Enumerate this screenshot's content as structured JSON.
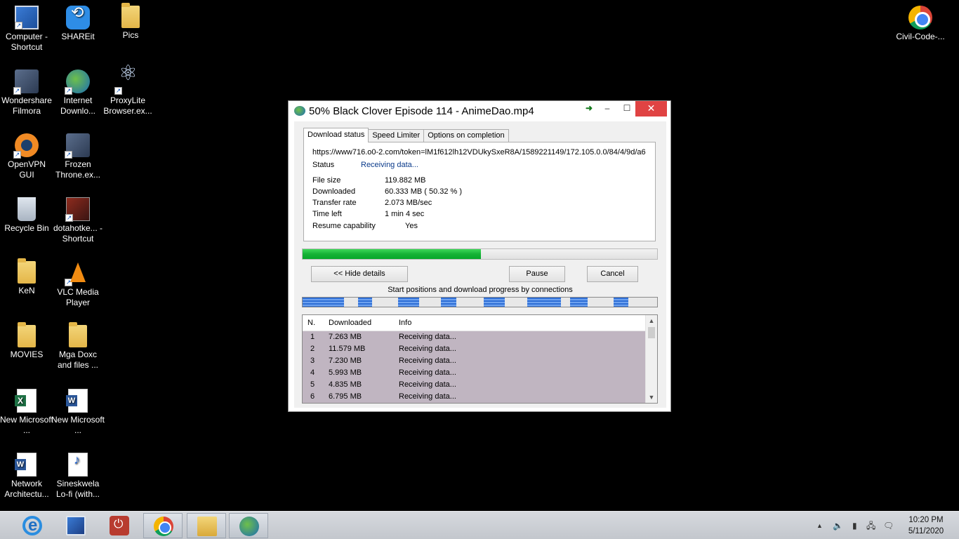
{
  "desktop": {
    "icons": [
      {
        "label": "Computer - Shortcut"
      },
      {
        "label": "SHAREit"
      },
      {
        "label": "Pics"
      },
      {
        "label": "Wondershare Filmora"
      },
      {
        "label": "Internet Downlo..."
      },
      {
        "label": "ProxyLite Browser.ex..."
      },
      {
        "label": "OpenVPN GUI"
      },
      {
        "label": "Frozen Throne.ex..."
      },
      {
        "label": "Recycle Bin"
      },
      {
        "label": "dotahotke... - Shortcut"
      },
      {
        "label": "KeN"
      },
      {
        "label": "VLC Media Player"
      },
      {
        "label": "MOVIES"
      },
      {
        "label": "Mga Doxc and files ..."
      },
      {
        "label": "New Microsoft ..."
      },
      {
        "label": "New Microsoft ..."
      },
      {
        "label": "Network Architectu..."
      },
      {
        "label": "Sineskwela Lo-fi (with..."
      },
      {
        "label": "Civil-Code-..."
      }
    ]
  },
  "window": {
    "title": "50% Black Clover Episode 114 - AnimeDao.mp4",
    "controls": {
      "arrow": "➜",
      "minimize": "–",
      "maximize": "☐",
      "close": "✕"
    },
    "tabs": [
      "Download status",
      "Speed Limiter",
      "Options on completion"
    ],
    "url": "https://www716.o0-2.com/token=lM1f612lh12VDUkySxeR8A/1589221149/172.105.0.0/84/4/9d/a6",
    "status_label": "Status",
    "status_value": "Receiving data...",
    "details": {
      "file_size_label": "File size",
      "file_size_value": "119.882  MB",
      "downloaded_label": "Downloaded",
      "downloaded_value": "60.333  MB  ( 50.32 % )",
      "transfer_rate_label": "Transfer rate",
      "transfer_rate_value": "2.073  MB/sec",
      "time_left_label": "Time left",
      "time_left_value": "1 min 4 sec",
      "resume_label": "Resume capability",
      "resume_value": "Yes"
    },
    "progress_percent": 50.32,
    "buttons": {
      "hide_details": "<< Hide details",
      "pause": "Pause",
      "cancel": "Cancel"
    },
    "connections_label": "Start positions and download progress by connections",
    "connections_table": {
      "headers": {
        "n": "N.",
        "downloaded": "Downloaded",
        "info": "Info"
      },
      "rows": [
        {
          "n": "1",
          "downloaded": "7.263  MB",
          "info": "Receiving data..."
        },
        {
          "n": "2",
          "downloaded": "11.579  MB",
          "info": "Receiving data..."
        },
        {
          "n": "3",
          "downloaded": "7.230  MB",
          "info": "Receiving data..."
        },
        {
          "n": "4",
          "downloaded": "5.993  MB",
          "info": "Receiving data..."
        },
        {
          "n": "5",
          "downloaded": "4.835  MB",
          "info": "Receiving data..."
        },
        {
          "n": "6",
          "downloaded": "6.795  MB",
          "info": "Receiving data..."
        }
      ]
    }
  },
  "taskbar": {
    "apps": [
      "internet-explorer",
      "control-panel",
      "shutdown",
      "chrome",
      "file-explorer",
      "internet-download-manager"
    ],
    "tray_icons": {
      "show_hidden": "▲",
      "volume": "🔈",
      "battery": "▮",
      "network": "🖧",
      "action_center": "🗨"
    },
    "time": "10:20 PM",
    "date": "5/11/2020"
  }
}
